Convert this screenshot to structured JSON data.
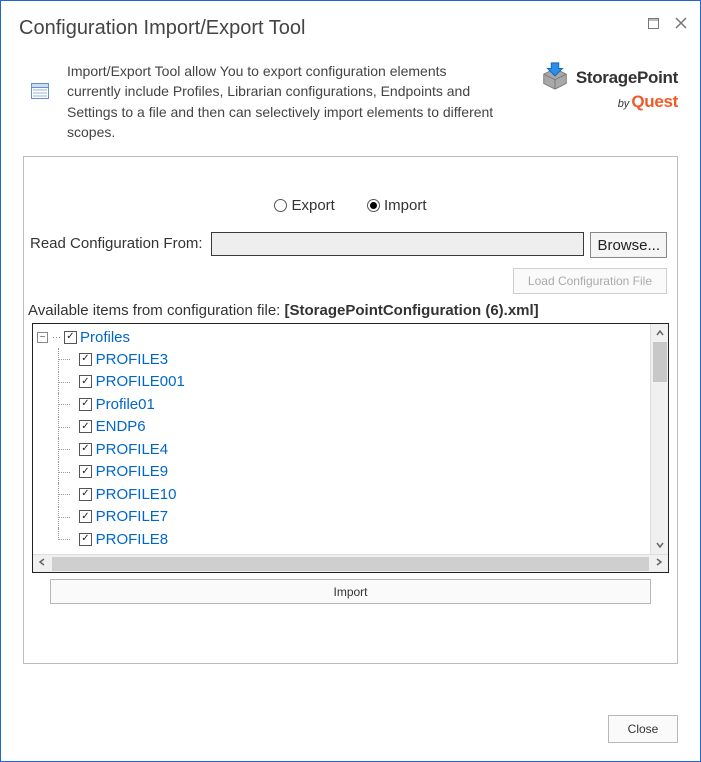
{
  "window": {
    "title": "Configuration Import/Export Tool"
  },
  "header": {
    "description": "Import/Export Tool allow You to export configuration elements currently include Profiles, Librarian configurations, Endpoints and Settings to a file and then can selectively import elements to different scopes.",
    "brand_line1": "StoragePoint",
    "brand_by": "by",
    "brand_line2": "Quest"
  },
  "mode": {
    "export_label": "Export",
    "import_label": "Import",
    "selected": "Import"
  },
  "read": {
    "label": "Read Configuration From:",
    "value": "",
    "browse_label": "Browse..."
  },
  "load": {
    "label": "Load Configuration File",
    "enabled": false
  },
  "available": {
    "prefix": "Available items from configuration file: ",
    "filename": "[StoragePointConfiguration (6).xml]"
  },
  "tree": {
    "root": {
      "label": "Profiles",
      "checked": true,
      "expanded": true
    },
    "items": [
      {
        "label": "PROFILE3",
        "checked": true
      },
      {
        "label": "PROFILE001",
        "checked": true
      },
      {
        "label": "Profile01",
        "checked": true
      },
      {
        "label": "ENDP6",
        "checked": true
      },
      {
        "label": "PROFILE4",
        "checked": true
      },
      {
        "label": "PROFILE9",
        "checked": true
      },
      {
        "label": "PROFILE10",
        "checked": true
      },
      {
        "label": "PROFILE7",
        "checked": true
      },
      {
        "label": "PROFILE8",
        "checked": true
      }
    ]
  },
  "actions": {
    "import_label": "Import",
    "close_label": "Close"
  }
}
